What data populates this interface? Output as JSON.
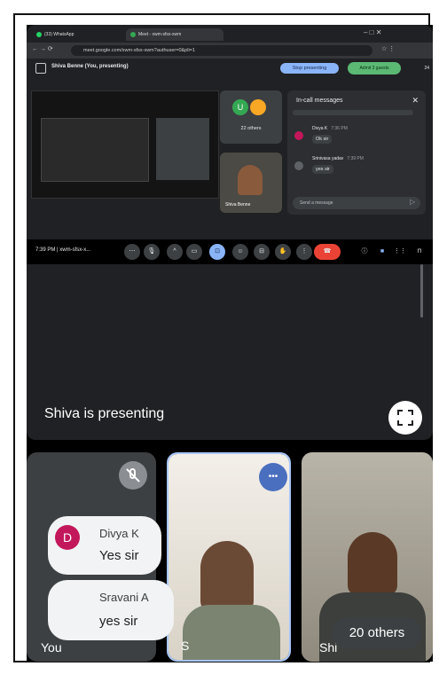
{
  "browser": {
    "tabs": [
      "(33) WhatsApp",
      "Meet - xwm-sfsx-xwm"
    ],
    "url": "meet.google.com/xwm-sfsx-xwm?authuser=0&pli=1"
  },
  "meet_bar": {
    "presenting_label": "Shiva Benne (You, presenting)",
    "stop_presenting": "Stop presenting",
    "admit_guests": "Admit 3 guests",
    "count": "24"
  },
  "tiles_small": {
    "others_label": "22 others",
    "shiva_label": "Shiva Benne"
  },
  "messages_panel": {
    "title": "In-call messages",
    "messages": [
      {
        "sender": "Divya K",
        "time": "7:36 PM",
        "text": "Ok sir"
      },
      {
        "sender": "Srinivasa yadav",
        "time": "7:39 PM",
        "text": "yes sir"
      }
    ],
    "input_placeholder": "Send a message"
  },
  "controls": {
    "time_meeting": "7:39 PM | xwm-sfsx-x..."
  },
  "presenting_banner": "Shiva is presenting",
  "participants": {
    "you_label": "You",
    "s_label": "S",
    "shiva_label": "Shi",
    "others": "20 others"
  },
  "chat_bubbles": [
    {
      "avatar": "D",
      "name": "Divya K",
      "text": "Yes sir"
    },
    {
      "name": "Sravani A",
      "text": "yes sir"
    }
  ],
  "colors": {
    "accent_blue": "#8ab4f8",
    "admit_green": "#5bb974",
    "end_call_red": "#ea4335",
    "avatar_pink": "#c2185b"
  }
}
